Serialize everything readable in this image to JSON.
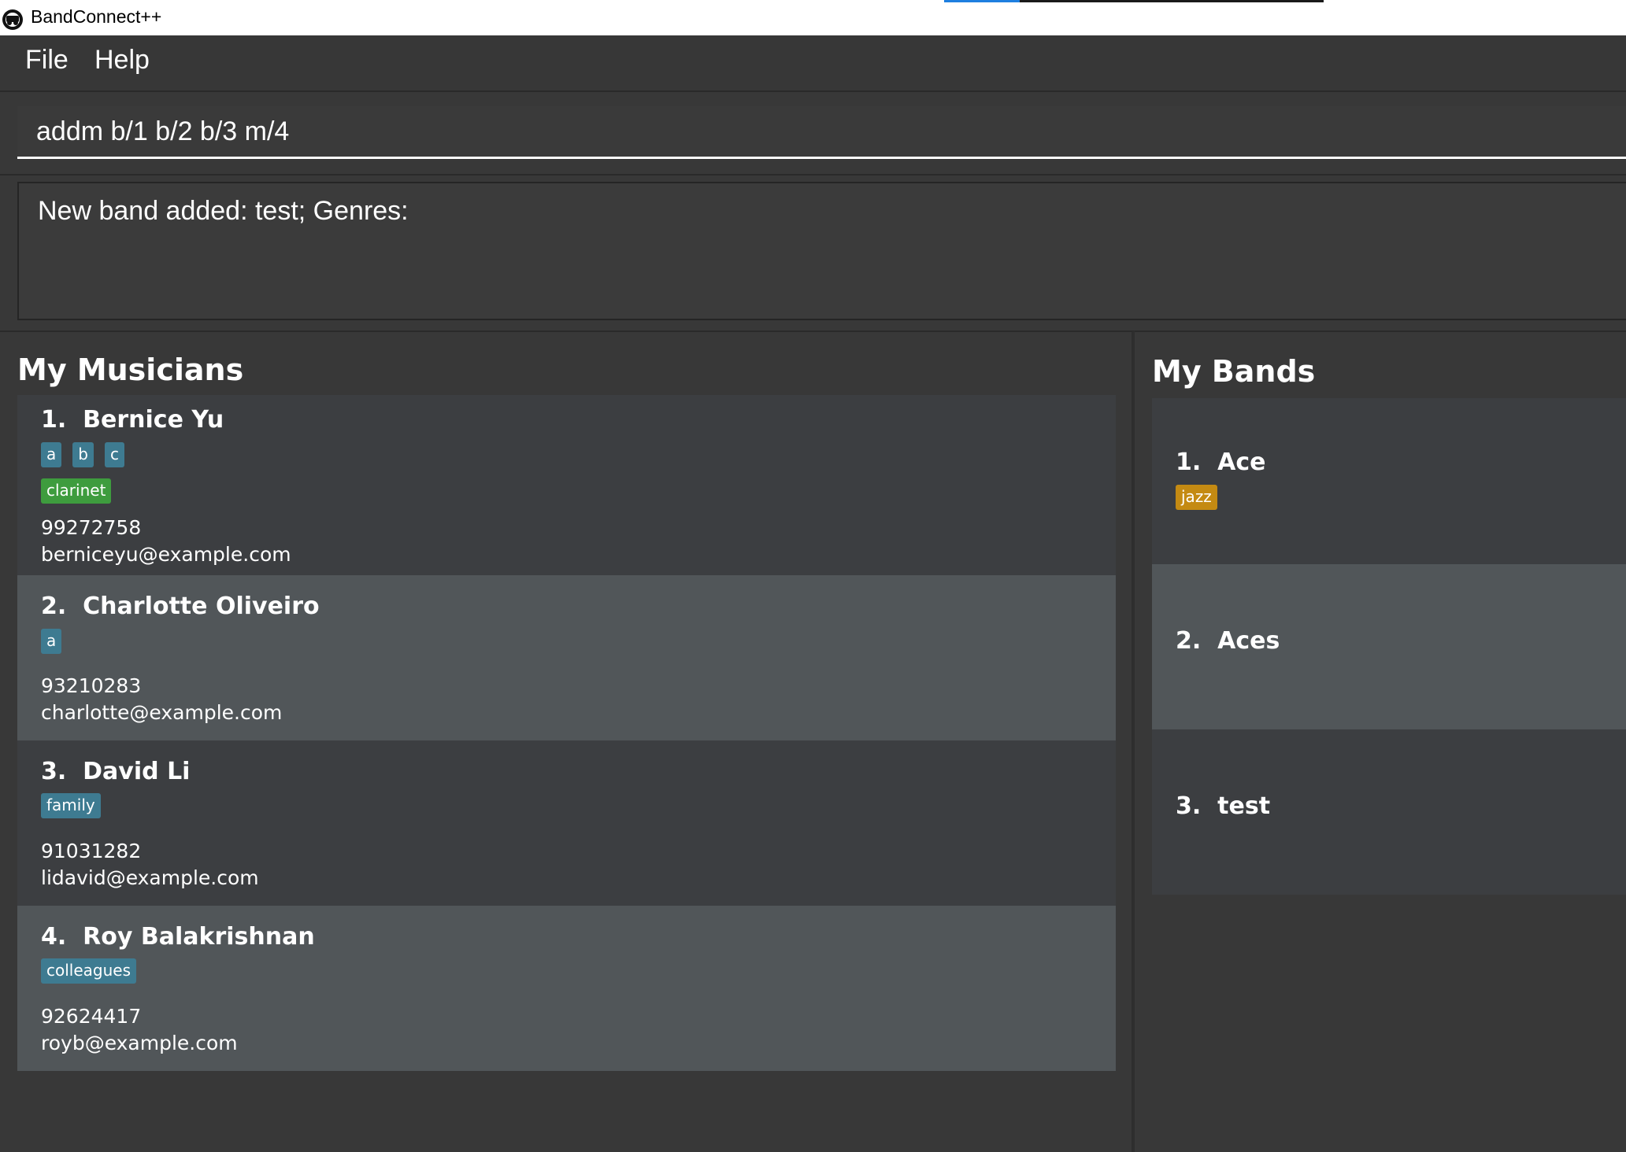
{
  "window": {
    "title": "BandConnect++"
  },
  "menu": {
    "file": "File",
    "help": "Help"
  },
  "command": {
    "value": "addm b/1 b/2 b/3 m/4"
  },
  "result": {
    "text": "New band added: test; Genres:"
  },
  "musicians": {
    "title": "My Musicians",
    "items": [
      {
        "name": "1.  Bernice Yu",
        "tags": [
          "a",
          "b",
          "c"
        ],
        "instruments": [
          "clarinet"
        ],
        "phone": "99272758",
        "email": "berniceyu@example.com"
      },
      {
        "name": "2.  Charlotte Oliveiro",
        "tags": [
          "a"
        ],
        "instruments": [],
        "phone": "93210283",
        "email": "charlotte@example.com"
      },
      {
        "name": "3.  David Li",
        "tags": [
          "family"
        ],
        "instruments": [],
        "phone": "91031282",
        "email": "lidavid@example.com"
      },
      {
        "name": "4.  Roy Balakrishnan",
        "tags": [
          "colleagues"
        ],
        "instruments": [],
        "phone": "92624417",
        "email": "royb@example.com"
      }
    ]
  },
  "bands": {
    "title": "My Bands",
    "items": [
      {
        "name": "1.  Ace",
        "genres": [
          "jazz"
        ]
      },
      {
        "name": "2.  Aces",
        "genres": []
      },
      {
        "name": "3.  test",
        "genres": []
      }
    ]
  },
  "colors": {
    "tag": "#3e7b91",
    "instrument": "#3e9c3e",
    "genre": "#c48a12",
    "card_dark": "#3c3e41",
    "card_light": "#515659"
  }
}
